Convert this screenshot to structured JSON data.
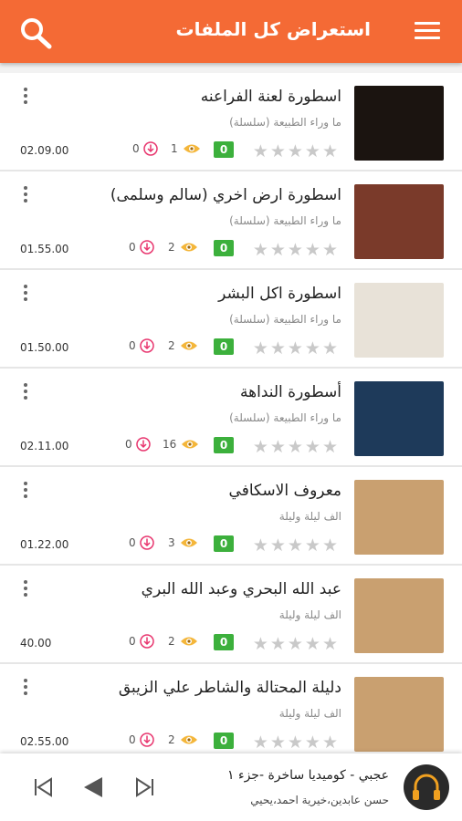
{
  "header": {
    "title": "استعراض كل الملفات"
  },
  "items": [
    {
      "title": "اسطورة لعنة الفراعنه",
      "subtitle": "ما وراء الطبيعة (سلسلة)",
      "rating": "0",
      "views": "1",
      "downloads": "0",
      "duration": "02.09.00",
      "thumb_color": "#1b1410"
    },
    {
      "title": "اسطورة ارض اخري (سالم وسلمى)",
      "subtitle": "ما وراء الطبيعة (سلسلة)",
      "rating": "0",
      "views": "2",
      "downloads": "0",
      "duration": "01.55.00",
      "thumb_color": "#7a3a2a"
    },
    {
      "title": "اسطورة اكل البشر",
      "subtitle": "ما وراء الطبيعة (سلسلة)",
      "rating": "0",
      "views": "2",
      "downloads": "0",
      "duration": "01.50.00",
      "thumb_color": "#e8e2d8"
    },
    {
      "title": "أسطورة النداهة",
      "subtitle": "ما وراء الطبيعة (سلسلة)",
      "rating": "0",
      "views": "16",
      "downloads": "0",
      "duration": "02.11.00",
      "thumb_color": "#1e3a5a"
    },
    {
      "title": "معروف الاسكافي",
      "subtitle": "الف ليلة وليلة",
      "rating": "0",
      "views": "3",
      "downloads": "0",
      "duration": "01.22.00",
      "thumb_color": "#c9a070"
    },
    {
      "title": "عبد الله البحري وعبد الله البري",
      "subtitle": "الف ليلة وليلة",
      "rating": "0",
      "views": "2",
      "downloads": "0",
      "duration": "40.00",
      "thumb_color": "#c9a070"
    },
    {
      "title": "دليلة المحتالة والشاطر علي الزيبق",
      "subtitle": "الف ليلة وليلة",
      "rating": "0",
      "views": "2",
      "downloads": "0",
      "duration": "02.55.00",
      "thumb_color": "#c9a070"
    }
  ],
  "player": {
    "title": "عجبي - كوميديا ساخرة -جزء ١",
    "author": "حسن عابدين،خيرية احمد،يحيي"
  },
  "colors": {
    "accent": "#f46a35",
    "badge": "#3cb03c",
    "download": "#e8356e"
  }
}
